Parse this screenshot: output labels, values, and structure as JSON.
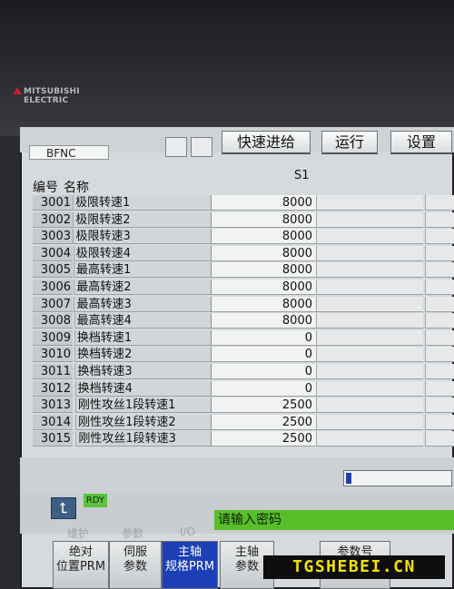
{
  "brand": {
    "line1": "MITSUBISHI",
    "line2": "ELECTRIC"
  },
  "tabs": {
    "mode": "BFNC",
    "quick": "快速进给",
    "run": "运行",
    "setup": "设置"
  },
  "table": {
    "col_no": "编号",
    "col_name": "名称",
    "col_s1": "S1",
    "rows": [
      {
        "no": "3001",
        "name": "极限转速1",
        "value": "8000"
      },
      {
        "no": "3002",
        "name": "极限转速2",
        "value": "8000"
      },
      {
        "no": "3003",
        "name": "极限转速3",
        "value": "8000"
      },
      {
        "no": "3004",
        "name": "极限转速4",
        "value": "8000"
      },
      {
        "no": "3005",
        "name": "最高转速1",
        "value": "8000"
      },
      {
        "no": "3006",
        "name": "最高转速2",
        "value": "8000"
      },
      {
        "no": "3007",
        "name": "最高转速3",
        "value": "8000"
      },
      {
        "no": "3008",
        "name": "最高转速4",
        "value": "8000"
      },
      {
        "no": "3009",
        "name": "换档转速1",
        "value": "0"
      },
      {
        "no": "3010",
        "name": "换档转速2",
        "value": "0"
      },
      {
        "no": "3011",
        "name": "换档转速3",
        "value": "0"
      },
      {
        "no": "3012",
        "name": "换档转速4",
        "value": "0"
      },
      {
        "no": "3013",
        "name": "刚性攻丝1段转速1",
        "value": "2500"
      },
      {
        "no": "3014",
        "name": "刚性攻丝1段转速2",
        "value": "2500"
      },
      {
        "no": "3015",
        "name": "刚性攻丝1段转速3",
        "value": "2500"
      }
    ]
  },
  "status": {
    "ready": "RDY",
    "message": "请输入密码",
    "progress": 0.05
  },
  "menu": {
    "top": [
      "维护",
      "参数",
      "I/O"
    ],
    "keys": [
      {
        "l1": "绝对",
        "l2": "位置PRM"
      },
      {
        "l1": "伺服",
        "l2": "参数"
      },
      {
        "l1": "主轴",
        "l2": "规格PRM"
      },
      {
        "l1": "主轴",
        "l2": "参数"
      },
      {
        "l1": "参数号",
        "l2": ""
      }
    ]
  },
  "watermark": "TGSHEBEI.CN",
  "colors": {
    "active_key": "#1c3fb5",
    "message_bg": "#58bf2b",
    "ready_bg": "#5ec23f"
  }
}
